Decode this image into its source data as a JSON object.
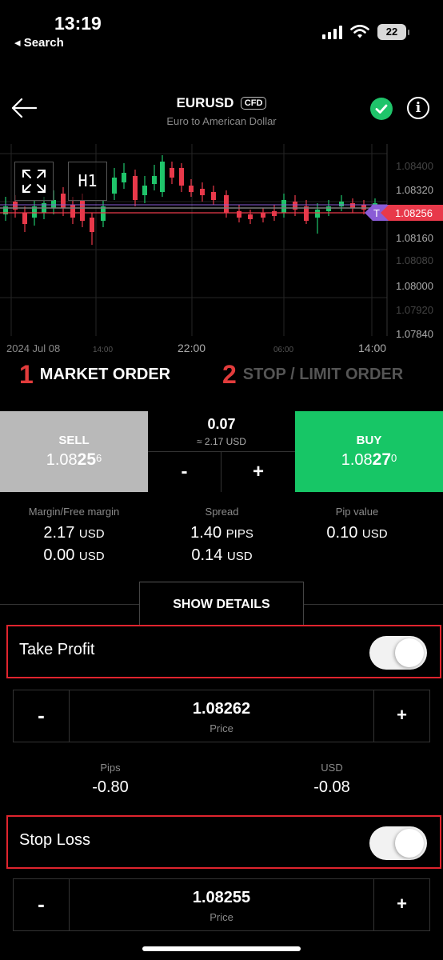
{
  "status_bar": {
    "time": "13:19",
    "back_label": "◂ Search",
    "battery": "22"
  },
  "header": {
    "symbol": "EURUSD",
    "badge": "CFD",
    "subtitle": "Euro to American Dollar"
  },
  "chart": {
    "timeframe": "H1",
    "price_labels": [
      "1.08400",
      "1.08320",
      "1.08256",
      "1.08160",
      "1.08080",
      "1.08000",
      "1.07920",
      "1.07840"
    ],
    "current_price_tag": "1.08256",
    "tp_marker": "T",
    "time_labels": [
      "2024 Jul 08",
      "14:00",
      "22:00",
      "06:00",
      "14:00"
    ],
    "colors": {
      "up": "#1fc46a",
      "down": "#e8394a",
      "grid": "#262626",
      "tag": "#e8394a",
      "tp_tag": "#8a5cd6"
    }
  },
  "order_types": [
    {
      "num": "1",
      "label": "MARKET ORDER"
    },
    {
      "num": "2",
      "label": "STOP / LIMIT ORDER"
    }
  ],
  "trade": {
    "sell": {
      "label": "SELL",
      "price_main": "1.08",
      "price_big": "25",
      "price_frac": "6"
    },
    "buy": {
      "label": "BUY",
      "price_main": "1.08",
      "price_big": "27",
      "price_frac": "0"
    },
    "quantity": "0.07",
    "approx": "≈ 2.17 USD",
    "minus": "-",
    "plus": "+"
  },
  "stats": [
    {
      "label": "Margin/Free margin",
      "v1": "2.17",
      "u1": "USD",
      "v2": "0.00",
      "u2": "USD"
    },
    {
      "label": "Spread",
      "v1": "1.40",
      "u1": "PIPS",
      "v2": "0.14",
      "u2": "USD"
    },
    {
      "label": "Pip value",
      "v1": "0.10",
      "u1": "USD"
    }
  ],
  "show_details": "SHOW DETAILS",
  "take_profit": {
    "label": "Take Profit",
    "enabled": true,
    "price": "1.08262",
    "price_label": "Price",
    "pips_label": "Pips",
    "pips": "-0.80",
    "usd_label": "USD",
    "usd": "-0.08"
  },
  "stop_loss": {
    "label": "Stop Loss",
    "enabled": true,
    "price": "1.08255",
    "price_label": "Price"
  },
  "stepper": {
    "minus": "-",
    "plus": "+"
  }
}
